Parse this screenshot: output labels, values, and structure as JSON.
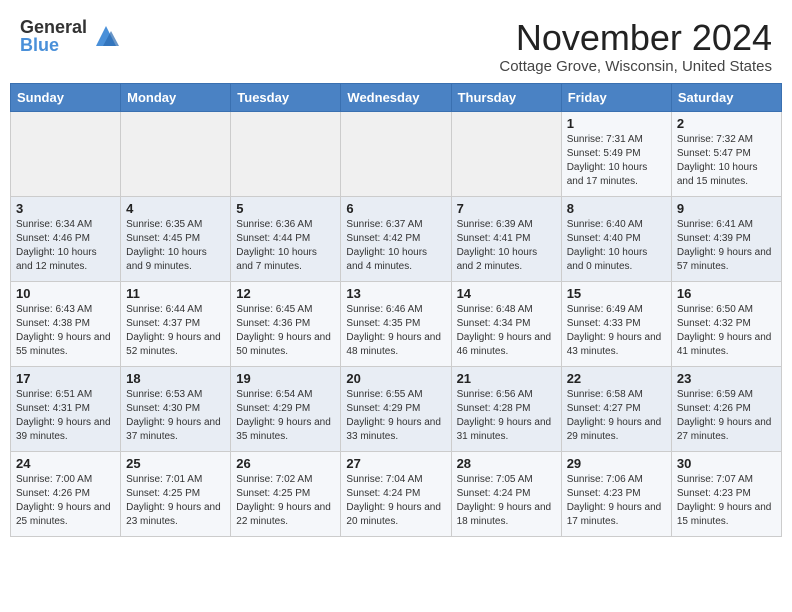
{
  "header": {
    "logo_general": "General",
    "logo_blue": "Blue",
    "month_title": "November 2024",
    "location": "Cottage Grove, Wisconsin, United States"
  },
  "calendar": {
    "days_of_week": [
      "Sunday",
      "Monday",
      "Tuesday",
      "Wednesday",
      "Thursday",
      "Friday",
      "Saturday"
    ],
    "weeks": [
      [
        {
          "day": "",
          "info": ""
        },
        {
          "day": "",
          "info": ""
        },
        {
          "day": "",
          "info": ""
        },
        {
          "day": "",
          "info": ""
        },
        {
          "day": "",
          "info": ""
        },
        {
          "day": "1",
          "info": "Sunrise: 7:31 AM\nSunset: 5:49 PM\nDaylight: 10 hours and 17 minutes."
        },
        {
          "day": "2",
          "info": "Sunrise: 7:32 AM\nSunset: 5:47 PM\nDaylight: 10 hours and 15 minutes."
        }
      ],
      [
        {
          "day": "3",
          "info": "Sunrise: 6:34 AM\nSunset: 4:46 PM\nDaylight: 10 hours and 12 minutes."
        },
        {
          "day": "4",
          "info": "Sunrise: 6:35 AM\nSunset: 4:45 PM\nDaylight: 10 hours and 9 minutes."
        },
        {
          "day": "5",
          "info": "Sunrise: 6:36 AM\nSunset: 4:44 PM\nDaylight: 10 hours and 7 minutes."
        },
        {
          "day": "6",
          "info": "Sunrise: 6:37 AM\nSunset: 4:42 PM\nDaylight: 10 hours and 4 minutes."
        },
        {
          "day": "7",
          "info": "Sunrise: 6:39 AM\nSunset: 4:41 PM\nDaylight: 10 hours and 2 minutes."
        },
        {
          "day": "8",
          "info": "Sunrise: 6:40 AM\nSunset: 4:40 PM\nDaylight: 10 hours and 0 minutes."
        },
        {
          "day": "9",
          "info": "Sunrise: 6:41 AM\nSunset: 4:39 PM\nDaylight: 9 hours and 57 minutes."
        }
      ],
      [
        {
          "day": "10",
          "info": "Sunrise: 6:43 AM\nSunset: 4:38 PM\nDaylight: 9 hours and 55 minutes."
        },
        {
          "day": "11",
          "info": "Sunrise: 6:44 AM\nSunset: 4:37 PM\nDaylight: 9 hours and 52 minutes."
        },
        {
          "day": "12",
          "info": "Sunrise: 6:45 AM\nSunset: 4:36 PM\nDaylight: 9 hours and 50 minutes."
        },
        {
          "day": "13",
          "info": "Sunrise: 6:46 AM\nSunset: 4:35 PM\nDaylight: 9 hours and 48 minutes."
        },
        {
          "day": "14",
          "info": "Sunrise: 6:48 AM\nSunset: 4:34 PM\nDaylight: 9 hours and 46 minutes."
        },
        {
          "day": "15",
          "info": "Sunrise: 6:49 AM\nSunset: 4:33 PM\nDaylight: 9 hours and 43 minutes."
        },
        {
          "day": "16",
          "info": "Sunrise: 6:50 AM\nSunset: 4:32 PM\nDaylight: 9 hours and 41 minutes."
        }
      ],
      [
        {
          "day": "17",
          "info": "Sunrise: 6:51 AM\nSunset: 4:31 PM\nDaylight: 9 hours and 39 minutes."
        },
        {
          "day": "18",
          "info": "Sunrise: 6:53 AM\nSunset: 4:30 PM\nDaylight: 9 hours and 37 minutes."
        },
        {
          "day": "19",
          "info": "Sunrise: 6:54 AM\nSunset: 4:29 PM\nDaylight: 9 hours and 35 minutes."
        },
        {
          "day": "20",
          "info": "Sunrise: 6:55 AM\nSunset: 4:29 PM\nDaylight: 9 hours and 33 minutes."
        },
        {
          "day": "21",
          "info": "Sunrise: 6:56 AM\nSunset: 4:28 PM\nDaylight: 9 hours and 31 minutes."
        },
        {
          "day": "22",
          "info": "Sunrise: 6:58 AM\nSunset: 4:27 PM\nDaylight: 9 hours and 29 minutes."
        },
        {
          "day": "23",
          "info": "Sunrise: 6:59 AM\nSunset: 4:26 PM\nDaylight: 9 hours and 27 minutes."
        }
      ],
      [
        {
          "day": "24",
          "info": "Sunrise: 7:00 AM\nSunset: 4:26 PM\nDaylight: 9 hours and 25 minutes."
        },
        {
          "day": "25",
          "info": "Sunrise: 7:01 AM\nSunset: 4:25 PM\nDaylight: 9 hours and 23 minutes."
        },
        {
          "day": "26",
          "info": "Sunrise: 7:02 AM\nSunset: 4:25 PM\nDaylight: 9 hours and 22 minutes."
        },
        {
          "day": "27",
          "info": "Sunrise: 7:04 AM\nSunset: 4:24 PM\nDaylight: 9 hours and 20 minutes."
        },
        {
          "day": "28",
          "info": "Sunrise: 7:05 AM\nSunset: 4:24 PM\nDaylight: 9 hours and 18 minutes."
        },
        {
          "day": "29",
          "info": "Sunrise: 7:06 AM\nSunset: 4:23 PM\nDaylight: 9 hours and 17 minutes."
        },
        {
          "day": "30",
          "info": "Sunrise: 7:07 AM\nSunset: 4:23 PM\nDaylight: 9 hours and 15 minutes."
        }
      ]
    ]
  }
}
